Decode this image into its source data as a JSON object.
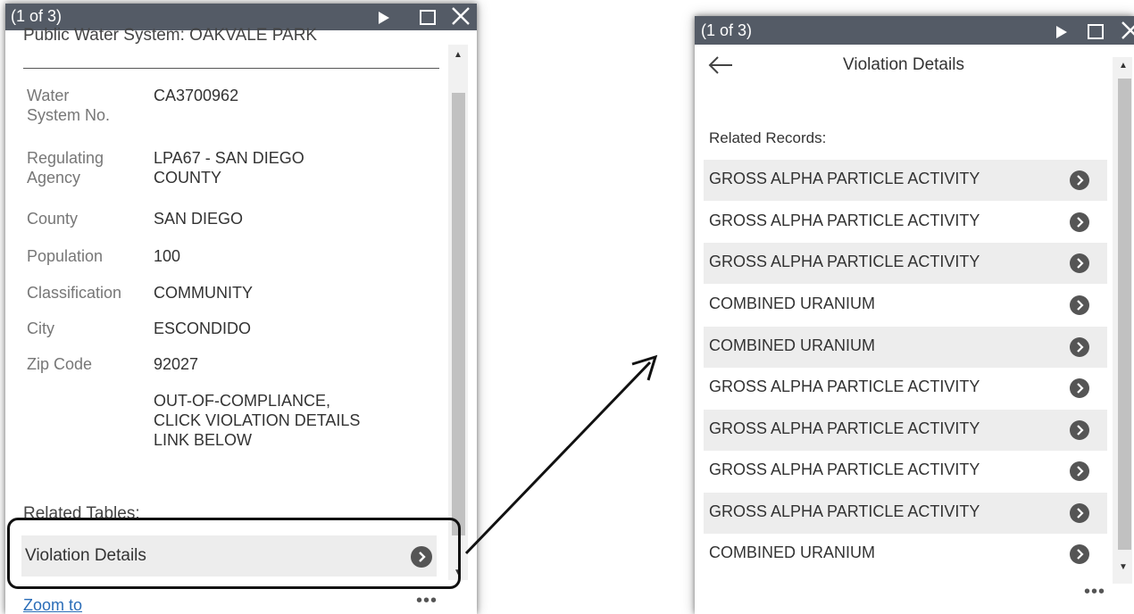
{
  "left_popup": {
    "count": "(1 of 3)",
    "feature_title": "Public Water System: OAKVALE PARK",
    "attributes": [
      {
        "label": "Water\nSystem No.",
        "value": "CA3700962"
      },
      {
        "label": "Regulating\nAgency",
        "value": "LPA67 - SAN DIEGO\nCOUNTY"
      },
      {
        "label": "County",
        "value": "SAN DIEGO"
      },
      {
        "label": "Population",
        "value": "100"
      },
      {
        "label": "Classification",
        "value": "COMMUNITY"
      },
      {
        "label": "City",
        "value": "ESCONDIDO"
      },
      {
        "label": "Zip Code",
        "value": "92027"
      },
      {
        "label": "",
        "value": "OUT-OF-COMPLIANCE,\nCLICK VIOLATION DETAILS\nLINK BELOW"
      }
    ],
    "related_tables_label": "Related Tables:",
    "related_item": "Violation Details",
    "zoom_link": "Zoom to",
    "more": "•••"
  },
  "right_popup": {
    "count": "(1 of 3)",
    "view_title": "Violation Details",
    "related_records_label": "Related Records:",
    "records": [
      "GROSS ALPHA PARTICLE ACTIVITY",
      "GROSS ALPHA PARTICLE ACTIVITY",
      "GROSS ALPHA PARTICLE ACTIVITY",
      "COMBINED URANIUM",
      "COMBINED URANIUM",
      "GROSS ALPHA PARTICLE ACTIVITY",
      "GROSS ALPHA PARTICLE ACTIVITY",
      "GROSS ALPHA PARTICLE ACTIVITY",
      "GROSS ALPHA PARTICLE ACTIVITY",
      "COMBINED URANIUM"
    ],
    "more": "•••"
  },
  "icons": {
    "next": "play-next-icon",
    "maximize": "maximize-icon",
    "close": "close-icon",
    "chevron": "chevron-right-circle-icon",
    "back": "back-arrow-icon"
  },
  "colors": {
    "titlebar": "#545b66",
    "chevron_circle": "#555555",
    "row_shade": "#ededed",
    "link": "#2a6db8"
  }
}
